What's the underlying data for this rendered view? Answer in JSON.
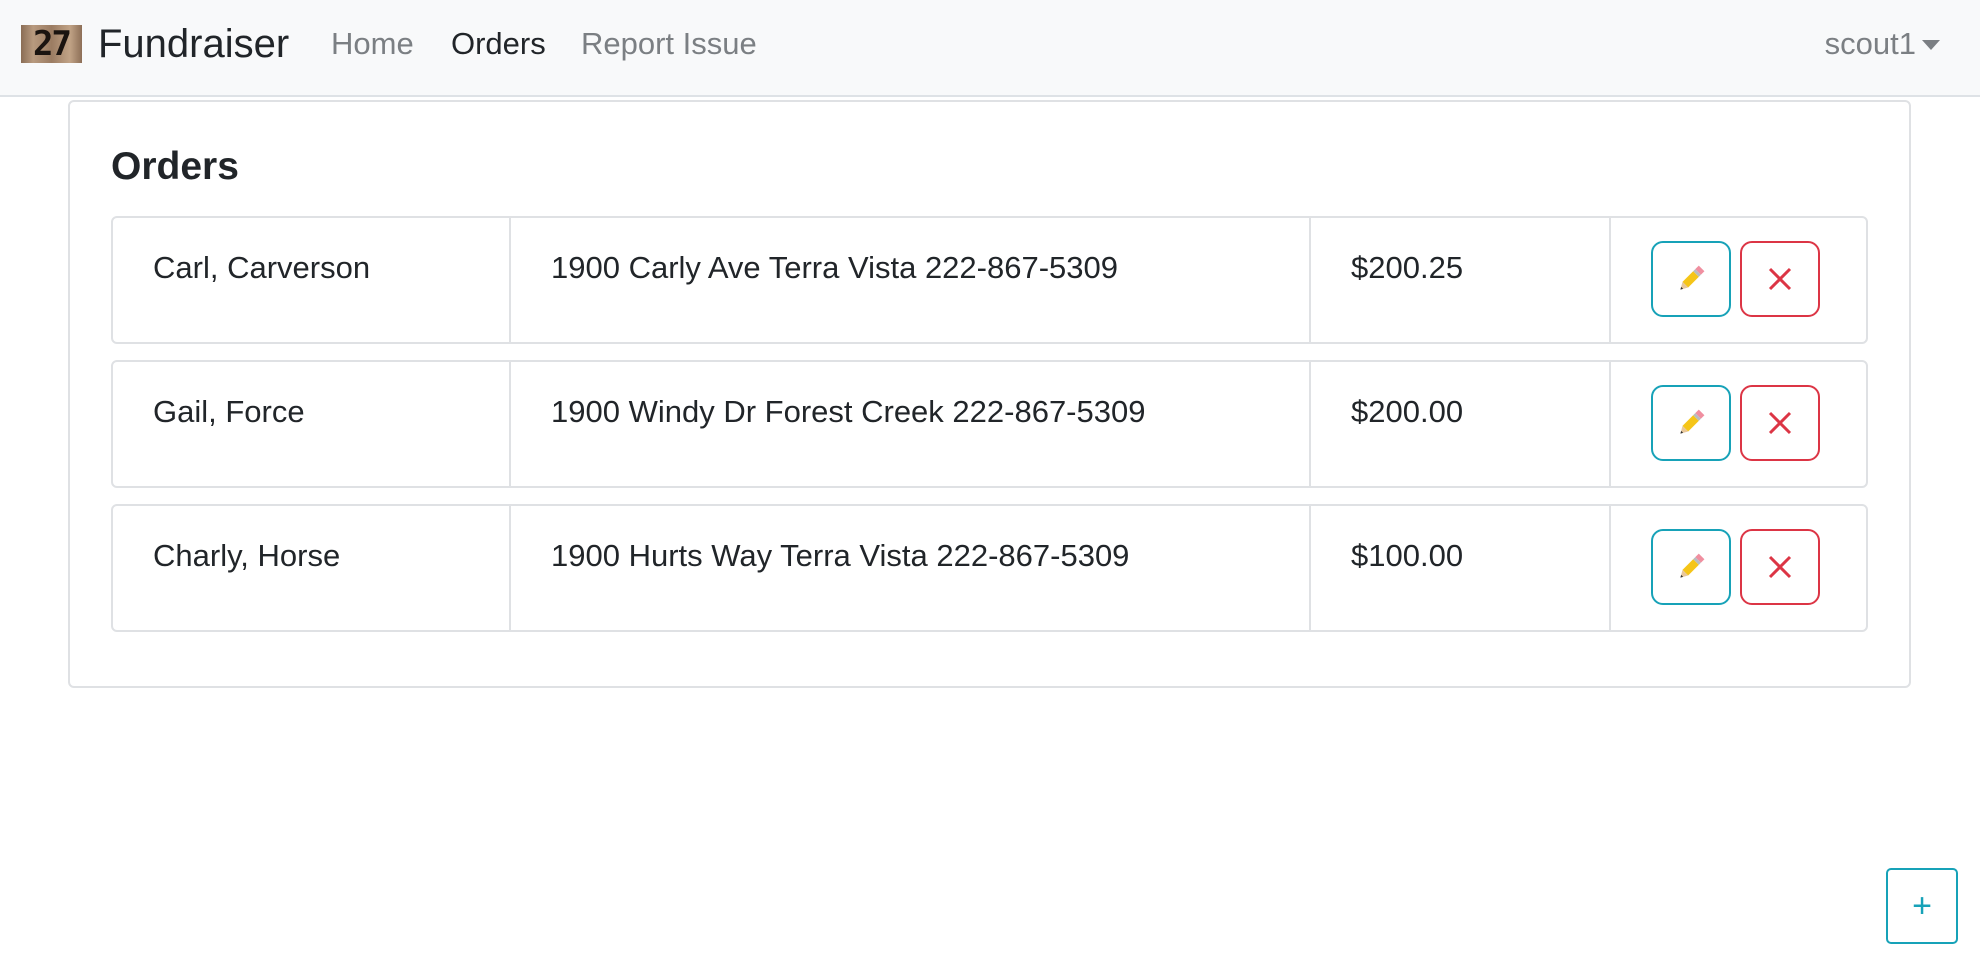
{
  "navbar": {
    "brand_logo_text": "27",
    "brand_name": "Fundraiser",
    "links": {
      "home": "Home",
      "orders": "Orders",
      "report_issue": "Report Issue"
    },
    "active_link": "Orders",
    "user": "scout1"
  },
  "main": {
    "title": "Orders",
    "orders": [
      {
        "name": "Carl, Carverson",
        "address": "1900 Carly Ave Terra Vista 222-867-5309",
        "amount": "$200.25"
      },
      {
        "name": "Gail, Force",
        "address": "1900 Windy Dr Forest Creek 222-867-5309",
        "amount": "$200.00"
      },
      {
        "name": "Charly, Horse",
        "address": "1900 Hurts Way Terra Vista 222-867-5309",
        "amount": "$100.00"
      }
    ]
  },
  "add_button": {
    "label": "+"
  },
  "icons": {
    "edit": "pencil-icon",
    "delete": "close-icon"
  },
  "colors": {
    "edit_border": "#17a2b8",
    "delete_border": "#dc3545",
    "navbar_bg": "#f8f9fa"
  }
}
